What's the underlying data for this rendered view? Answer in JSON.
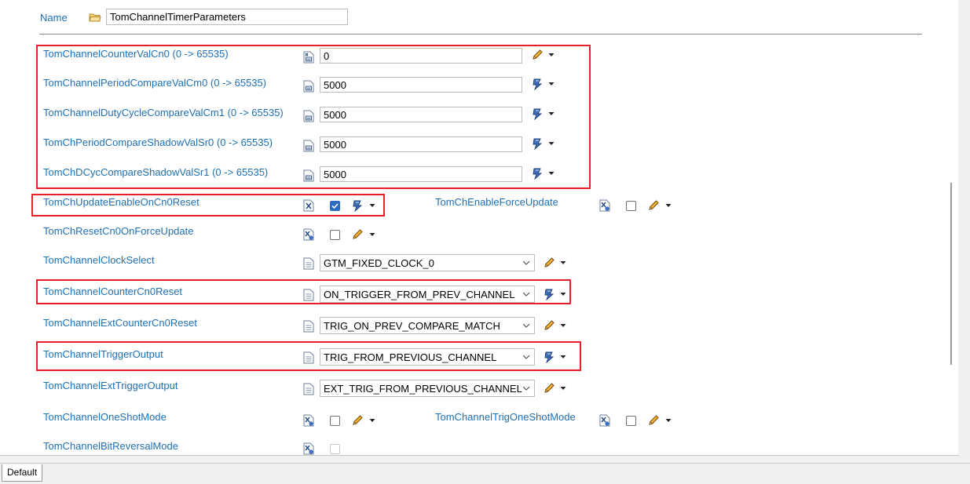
{
  "name_row": {
    "label": "Name",
    "value": "TomChannelTimerParameters"
  },
  "rows": {
    "counter_val_cn0": {
      "label": "TomChannelCounterValCn0 (0 -> 65535)",
      "value": "0"
    },
    "period_compare_cm0": {
      "label": "TomChannelPeriodCompareValCm0 (0 -> 65535)",
      "value": "5000"
    },
    "duty_cycle_cm1": {
      "label": "TomChannelDutyCycleCompareValCm1 (0 -> 65535)",
      "value": "5000"
    },
    "period_shadow_sr0": {
      "label": "TomChPeriodCompareShadowValSr0 (0 -> 65535)",
      "value": "5000"
    },
    "dcyc_shadow_sr1": {
      "label": "TomChDCycCompareShadowValSr1 (0 -> 65535)",
      "value": "5000"
    },
    "update_enable_on_cn0_reset": {
      "label": "TomChUpdateEnableOnCn0Reset",
      "checked": true
    },
    "enable_force_update": {
      "label": "TomChEnableForceUpdate",
      "checked": false
    },
    "reset_cn0_on_force_update": {
      "label": "TomChResetCn0OnForceUpdate",
      "checked": false
    },
    "clock_select": {
      "label": "TomChannelClockSelect",
      "value": "GTM_FIXED_CLOCK_0"
    },
    "counter_cn0_reset": {
      "label": "TomChannelCounterCn0Reset",
      "value": "ON_TRIGGER_FROM_PREV_CHANNEL"
    },
    "ext_counter_cn0_reset": {
      "label": "TomChannelExtCounterCn0Reset",
      "value": "TRIG_ON_PREV_COMPARE_MATCH"
    },
    "trigger_output": {
      "label": "TomChannelTriggerOutput",
      "value": "TRIG_FROM_PREVIOUS_CHANNEL"
    },
    "ext_trigger_output": {
      "label": "TomChannelExtTriggerOutput",
      "value": "EXT_TRIG_FROM_PREVIOUS_CHANNEL"
    },
    "one_shot_mode": {
      "label": "TomChannelOneShotMode",
      "checked": false
    },
    "trig_one_shot_mode": {
      "label": "TomChannelTrigOneShotMode",
      "checked": false
    },
    "bit_reversal_mode": {
      "label": "TomChannelBitReversalMode",
      "checked": false
    }
  },
  "tabs": {
    "default": "Default"
  },
  "colors": {
    "label_blue": "#1f6fb5",
    "highlight_red": "#e5202a",
    "checkbox_blue": "#2d6cc0"
  }
}
